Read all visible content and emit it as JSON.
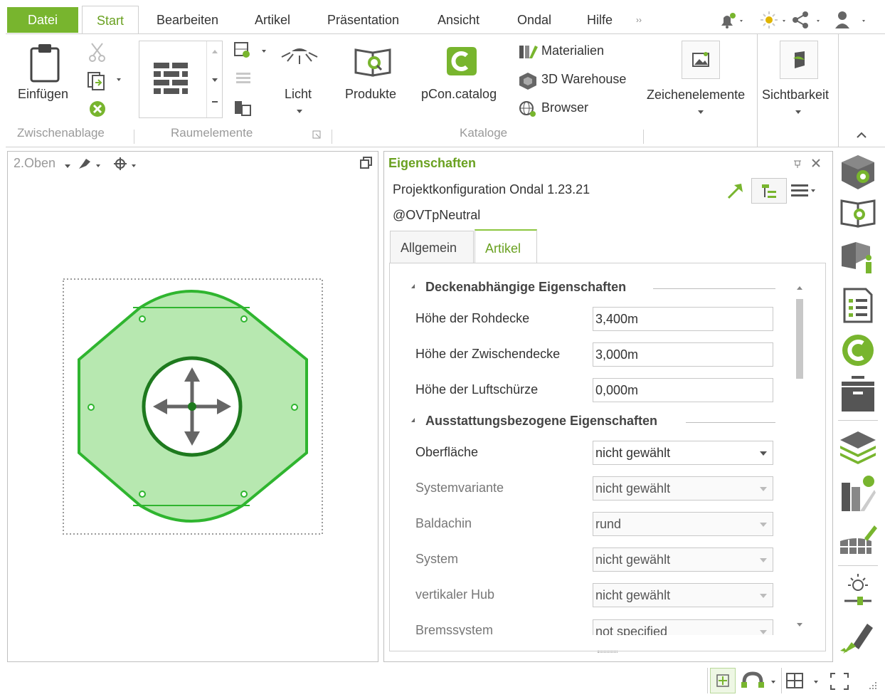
{
  "menu": {
    "datei": "Datei",
    "start": "Start",
    "bearbeiten": "Bearbeiten",
    "artikel": "Artikel",
    "praesentation": "Präsentation",
    "ansicht": "Ansicht",
    "ondal": "Ondal",
    "hilfe": "Hilfe",
    "more": "››"
  },
  "ribbon": {
    "einfuegen": "Einfügen",
    "licht": "Licht",
    "produkte": "Produkte",
    "pcon_catalog": "pCon.catalog",
    "materialien": "Materialien",
    "warehouse": "3D Warehouse",
    "browser": "Browser",
    "zeichenelemente": "Zeichenelemente",
    "sichtbarkeit": "Sichtbarkeit",
    "groups": {
      "zwischenablage": "Zwischenablage",
      "raumelemente": "Raumelemente",
      "kataloge": "Kataloge"
    }
  },
  "viewport": {
    "view_name": "2.Oben"
  },
  "properties": {
    "title": "Eigenschaften",
    "config_name": "Projektkonfiguration Ondal 1.23.21",
    "config_sub": "@OVTpNeutral",
    "tabs": [
      "Allgemein",
      "Artikel"
    ],
    "sections": [
      {
        "title": "Deckenabhängige Eigenschaften",
        "rows": [
          {
            "label": "Höhe der Rohdecke",
            "value": "3,400m"
          },
          {
            "label": "Höhe der Zwischendecke",
            "value": "3,000m"
          },
          {
            "label": "Höhe der Luftschürze",
            "value": "0,000m"
          }
        ]
      },
      {
        "title": "Ausstattungsbezogene Eigenschaften",
        "rows": [
          {
            "label": "Oberfläche",
            "value": "nicht gewählt"
          },
          {
            "label": "Systemvariante",
            "value": "nicht gewählt"
          },
          {
            "label": "Baldachin",
            "value": "rund"
          },
          {
            "label": "System",
            "value": "nicht gewählt"
          },
          {
            "label": "vertikaler Hub",
            "value": "nicht gewählt"
          },
          {
            "label": "Bremssystem",
            "value": "not specified"
          }
        ]
      }
    ]
  },
  "colors": {
    "accent": "#78b52e",
    "accent_text": "#6aa121",
    "shape_fill": "#b7e8b0",
    "shape_stroke": "#2fb52f",
    "inner_ring": "#1e7a1e"
  }
}
